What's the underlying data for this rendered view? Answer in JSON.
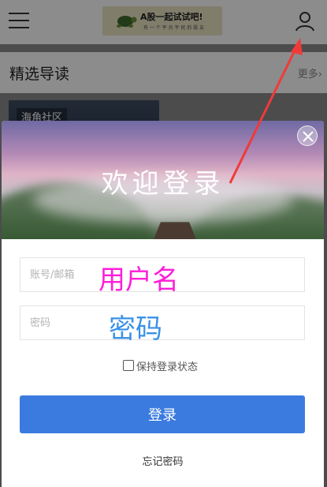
{
  "header": {
    "logo_title": "A股一起试试吧!",
    "logo_subtitle": "有 一 个 平 台 平 民 的 股 友"
  },
  "section": {
    "title": "精选导读",
    "more_label": "更多›",
    "thumb_label": "海角社区"
  },
  "modal": {
    "title": "欢迎登录",
    "username_placeholder": "账号/邮箱",
    "password_placeholder": "密码",
    "remember_label": "保持登录状态",
    "login_button": "登录",
    "forgot_label": "忘记密码"
  },
  "annotations": {
    "username_note": "用户名",
    "password_note": "密码",
    "username_color": "#ff1ed8",
    "password_color": "#3a91e6",
    "arrow_color": "#f03a3a"
  },
  "colors": {
    "primary": "#3b7be0"
  }
}
